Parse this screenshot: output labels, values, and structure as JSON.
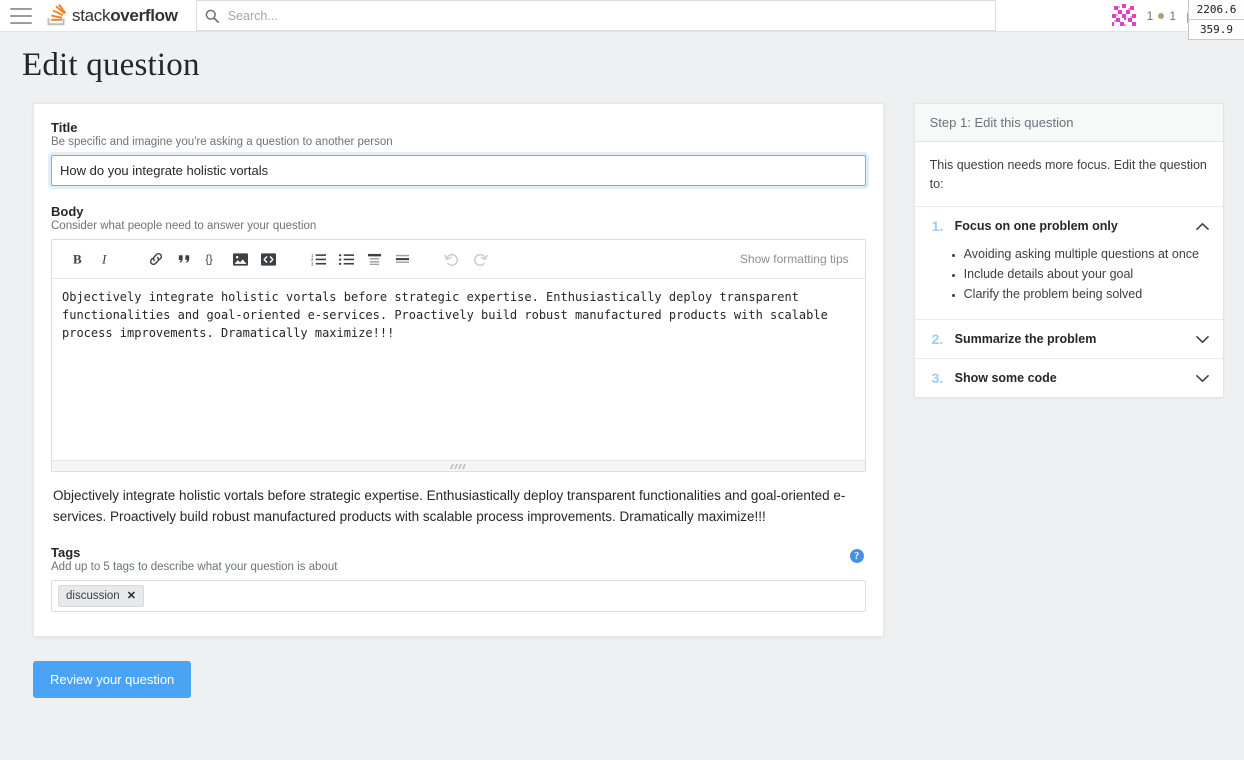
{
  "topbar": {
    "menu_label": "menu",
    "logo_text_light": "stack",
    "logo_text_bold": "overflow",
    "search_placeholder": "Search...",
    "reputation": "1",
    "badge_count": "1",
    "inbox_label": "inbox",
    "achievements_label": "achievements"
  },
  "readouts": {
    "value_x": "2206.6",
    "value_y": "359.9"
  },
  "page": {
    "title": "Edit question"
  },
  "form": {
    "title_label": "Title",
    "title_hint": "Be specific and imagine you're asking a question to another person",
    "title_value": "How do you integrate holistic vortals",
    "body_label": "Body",
    "body_hint": "Consider what people need to answer your question",
    "body_value": "Objectively integrate holistic vortals before strategic expertise. Enthusiastically deploy transparent functionalities and goal-oriented e-services. Proactively build robust manufactured products with scalable process improvements. Dramatically maximize!!!",
    "preview_text": "Objectively integrate holistic vortals before strategic expertise. Enthusiastically deploy transparent functionalities and goal-oriented e-services. Proactively build robust manufactured products with scalable process improvements. Dramatically maximize!!!",
    "formatting_tips": "Show formatting tips",
    "tags_label": "Tags",
    "tags_hint": "Add up to 5 tags to describe what your question is about",
    "tag_chips": [
      {
        "label": "discussion",
        "remove": "✕"
      }
    ],
    "help_glyph": "?"
  },
  "toolbar_buttons": [
    {
      "name": "bold",
      "label": "B"
    },
    {
      "name": "italic",
      "label": "I"
    },
    {
      "name": "link",
      "label": ""
    },
    {
      "name": "blockquote",
      "label": ""
    },
    {
      "name": "code",
      "label": "{}"
    },
    {
      "name": "image",
      "label": ""
    },
    {
      "name": "stack-snippet",
      "label": ""
    },
    {
      "name": "numbered-list",
      "label": ""
    },
    {
      "name": "bulleted-list",
      "label": ""
    },
    {
      "name": "heading",
      "label": ""
    },
    {
      "name": "horizontal-rule",
      "label": ""
    },
    {
      "name": "undo",
      "label": ""
    },
    {
      "name": "redo",
      "label": ""
    }
  ],
  "sidebar": {
    "header": "Step 1: Edit this question",
    "intro": "This question needs more focus. Edit the question to:",
    "items": [
      {
        "num": "1.",
        "title": "Focus on one problem only",
        "expanded": true,
        "bullets": [
          "Avoiding asking multiple questions at once",
          "Include details about your goal",
          "Clarify the problem being solved"
        ]
      },
      {
        "num": "2.",
        "title": "Summarize the problem",
        "expanded": false,
        "bullets": []
      },
      {
        "num": "3.",
        "title": "Show some code",
        "expanded": false,
        "bullets": []
      }
    ]
  },
  "footer": {
    "submit_label": "Review your question"
  },
  "colors": {
    "accent_blue": "#4aa3f5",
    "focus_blue": "#6cb1ef",
    "step_number": "#9ecbf5",
    "page_bg": "#eff0f1",
    "orange": "#f48024"
  }
}
